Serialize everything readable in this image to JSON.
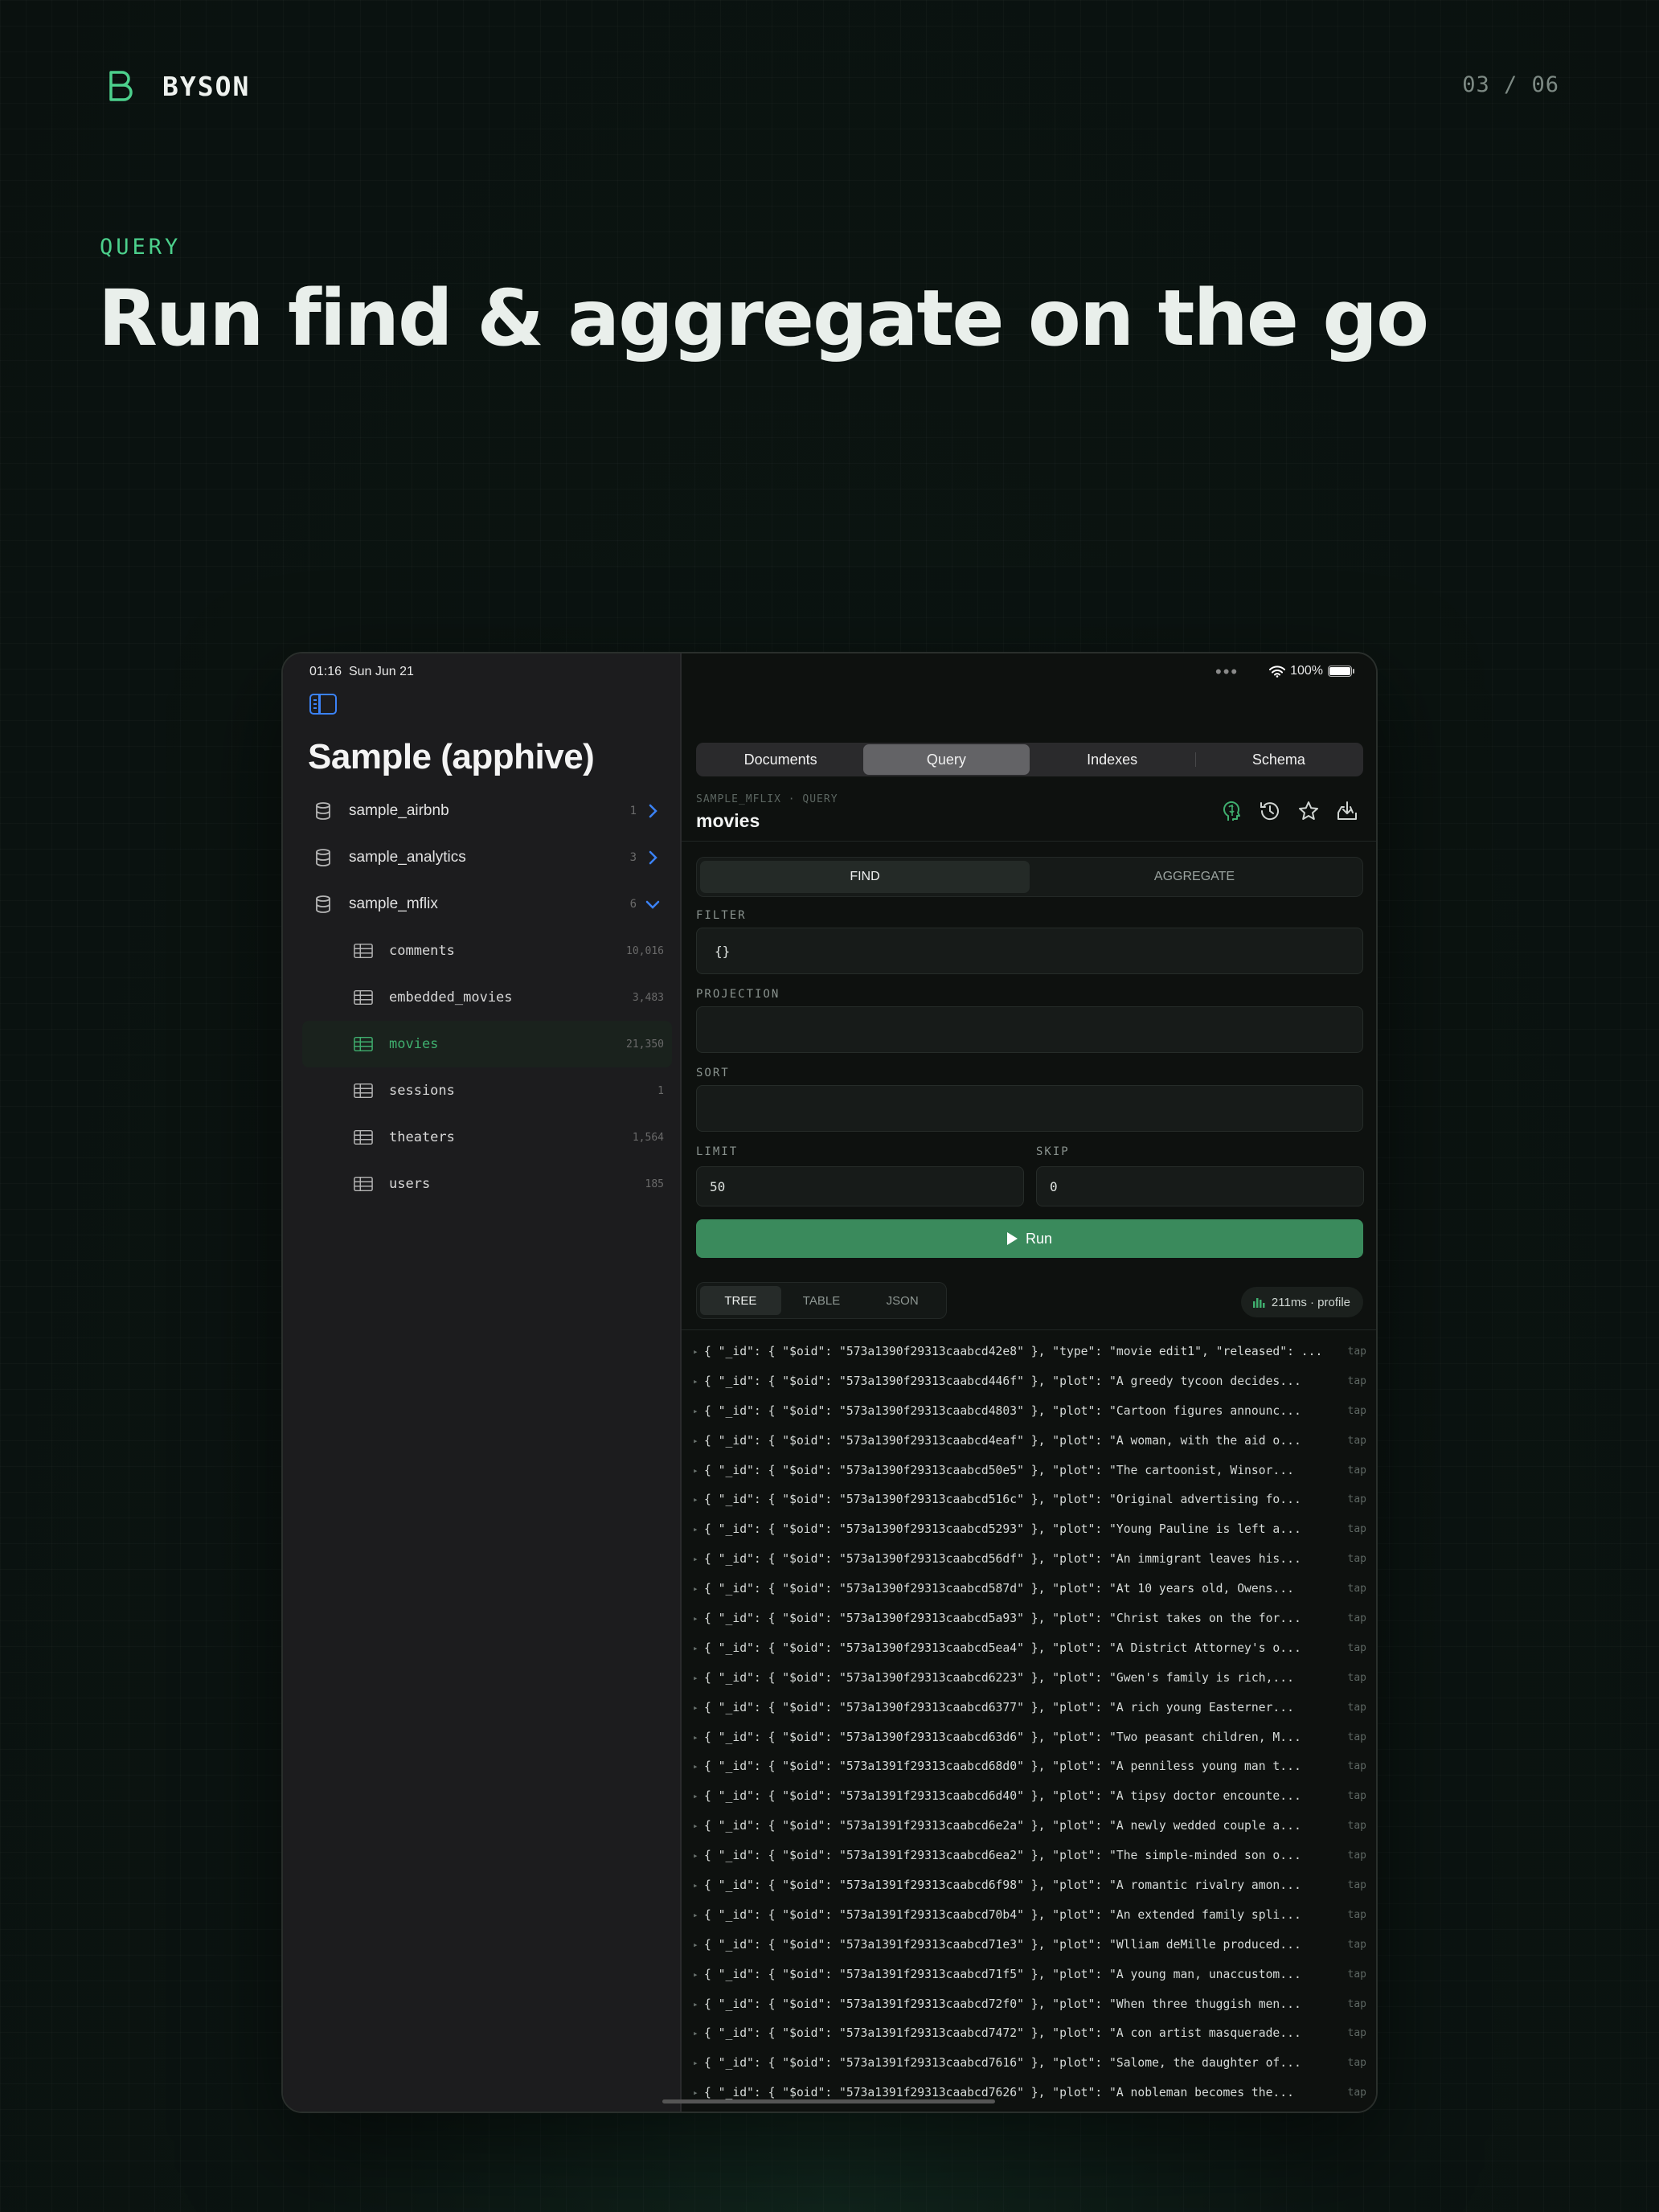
{
  "brand": {
    "name": "BYSON",
    "page_counter": "03 / 06"
  },
  "hero": {
    "eyebrow": "QUERY",
    "headline": "Run find & aggregate on the go"
  },
  "status_bar": {
    "time": "01:16",
    "date": "Sun Jun 21",
    "battery": "100%"
  },
  "sidebar": {
    "title": "Sample (apphive)",
    "databases": [
      {
        "name": "sample_airbnb",
        "count": "1"
      },
      {
        "name": "sample_analytics",
        "count": "3"
      },
      {
        "name": "sample_mflix",
        "count": "6",
        "expanded": true
      }
    ],
    "collections": [
      {
        "name": "comments",
        "count": "10,016"
      },
      {
        "name": "embedded_movies",
        "count": "3,483"
      },
      {
        "name": "movies",
        "count": "21,350",
        "active": true
      },
      {
        "name": "sessions",
        "count": "1"
      },
      {
        "name": "theaters",
        "count": "1,564"
      },
      {
        "name": "users",
        "count": "185"
      }
    ]
  },
  "tabs": {
    "documents": "Documents",
    "query": "Query",
    "indexes": "Indexes",
    "schema": "Schema",
    "active": "Query"
  },
  "query": {
    "breadcrumb": "SAMPLE_MFLIX · QUERY",
    "collection": "movies",
    "mode": {
      "find": "FIND",
      "aggregate": "AGGREGATE",
      "active": "FIND"
    },
    "filter_label": "FILTER",
    "filter_value": "{}",
    "projection_label": "PROJECTION",
    "projection_value": "",
    "sort_label": "SORT",
    "sort_value": "",
    "limit_label": "LIMIT",
    "limit_value": "50",
    "skip_label": "SKIP",
    "skip_value": "0",
    "run_label": "Run"
  },
  "results_view": {
    "tree": "TREE",
    "table": "TABLE",
    "json": "JSON",
    "active": "TREE",
    "profile": "211ms · profile",
    "tap_label": "tap"
  },
  "results": [
    "{ \"_id\": { \"$oid\": \"573a1390f29313caabcd42e8\" }, \"type\": \"movie edit1\", \"released\": ...",
    "{ \"_id\": { \"$oid\": \"573a1390f29313caabcd446f\" }, \"plot\": \"A greedy tycoon decides...",
    "{ \"_id\": { \"$oid\": \"573a1390f29313caabcd4803\" }, \"plot\": \"Cartoon figures announc...",
    "{ \"_id\": { \"$oid\": \"573a1390f29313caabcd4eaf\" }, \"plot\": \"A woman, with the aid o...",
    "{ \"_id\": { \"$oid\": \"573a1390f29313caabcd50e5\" }, \"plot\": \"The cartoonist, Winsor...",
    "{ \"_id\": { \"$oid\": \"573a1390f29313caabcd516c\" }, \"plot\": \"Original advertising fo...",
    "{ \"_id\": { \"$oid\": \"573a1390f29313caabcd5293\" }, \"plot\": \"Young Pauline is left a...",
    "{ \"_id\": { \"$oid\": \"573a1390f29313caabcd56df\" }, \"plot\": \"An immigrant leaves his...",
    "{ \"_id\": { \"$oid\": \"573a1390f29313caabcd587d\" }, \"plot\": \"At 10 years old, Owens...",
    "{ \"_id\": { \"$oid\": \"573a1390f29313caabcd5a93\" }, \"plot\": \"Christ takes on the for...",
    "{ \"_id\": { \"$oid\": \"573a1390f29313caabcd5ea4\" }, \"plot\": \"A District Attorney's o...",
    "{ \"_id\": { \"$oid\": \"573a1390f29313caabcd6223\" }, \"plot\": \"Gwen's family is rich,...",
    "{ \"_id\": { \"$oid\": \"573a1390f29313caabcd6377\" }, \"plot\": \"A rich young Easterner...",
    "{ \"_id\": { \"$oid\": \"573a1390f29313caabcd63d6\" }, \"plot\": \"Two peasant children, M...",
    "{ \"_id\": { \"$oid\": \"573a1391f29313caabcd68d0\" }, \"plot\": \"A penniless young man t...",
    "{ \"_id\": { \"$oid\": \"573a1391f29313caabcd6d40\" }, \"plot\": \"A tipsy doctor encounte...",
    "{ \"_id\": { \"$oid\": \"573a1391f29313caabcd6e2a\" }, \"plot\": \"A newly wedded couple a...",
    "{ \"_id\": { \"$oid\": \"573a1391f29313caabcd6ea2\" }, \"plot\": \"The simple-minded son o...",
    "{ \"_id\": { \"$oid\": \"573a1391f29313caabcd6f98\" }, \"plot\": \"A romantic rivalry amon...",
    "{ \"_id\": { \"$oid\": \"573a1391f29313caabcd70b4\" }, \"plot\": \"An extended family spli...",
    "{ \"_id\": { \"$oid\": \"573a1391f29313caabcd71e3\" }, \"plot\": \"Wlliam deMille produced...",
    "{ \"_id\": { \"$oid\": \"573a1391f29313caabcd71f5\" }, \"plot\": \"A young man, unaccustom...",
    "{ \"_id\": { \"$oid\": \"573a1391f29313caabcd72f0\" }, \"plot\": \"When three thuggish men...",
    "{ \"_id\": { \"$oid\": \"573a1391f29313caabcd7472\" }, \"plot\": \"A con artist masquerade...",
    "{ \"_id\": { \"$oid\": \"573a1391f29313caabcd7616\" }, \"plot\": \"Salome, the daughter of...",
    "{ \"_id\": { \"$oid\": \"573a1391f29313caabcd7626\" }, \"plot\": \"A nobleman becomes the..."
  ],
  "colors": {
    "accent_green": "#4cd08c",
    "run_button": "#3a8a5c",
    "ios_blue": "#3b82f6"
  },
  "icons": {
    "brand": "byson-logo-icon",
    "database": "database-icon",
    "collection": "table-icon",
    "actions": [
      "brain-icon",
      "history-icon",
      "star-icon",
      "download-icon"
    ]
  }
}
